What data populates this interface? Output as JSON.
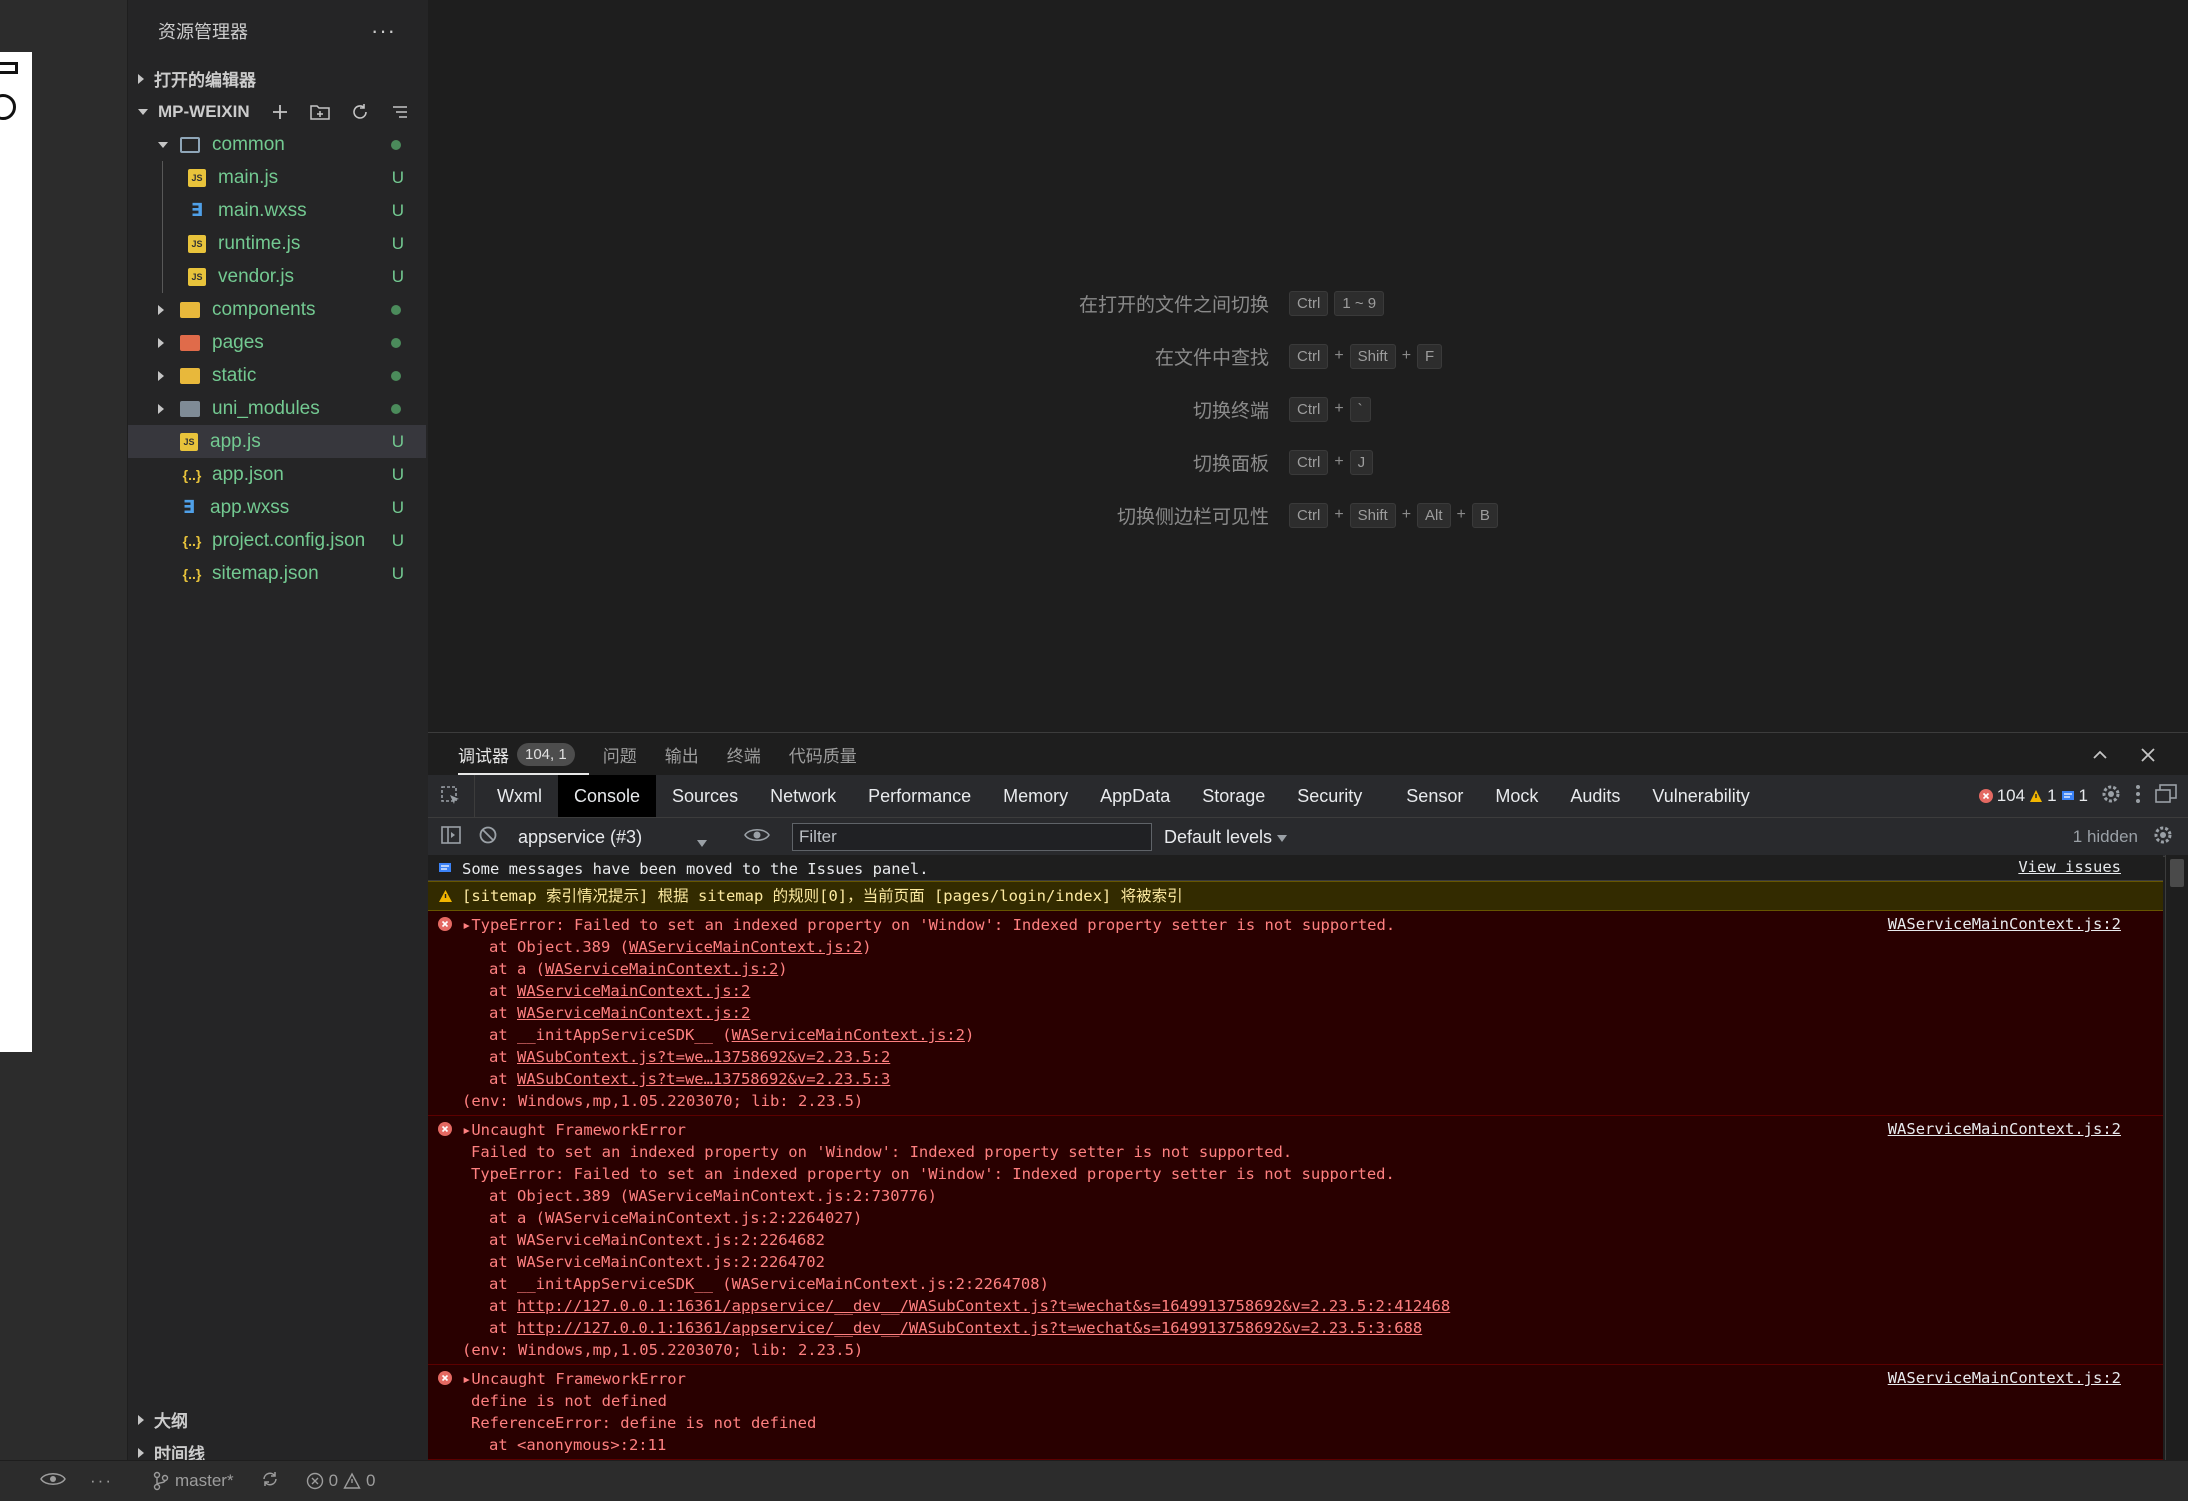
{
  "sidebar": {
    "title": "资源管理器",
    "more": "···",
    "open_editors_label": "打开的编辑器",
    "project_label": "MP-WEIXIN",
    "outline_label": "大纲",
    "timeline_label": "时间线",
    "tree": [
      {
        "name": "common",
        "type": "folder-open",
        "depth": 0,
        "status": "dot"
      },
      {
        "name": "main.js",
        "type": "js",
        "depth": 1,
        "status": "U"
      },
      {
        "name": "main.wxss",
        "type": "wxss",
        "depth": 1,
        "status": "U"
      },
      {
        "name": "runtime.js",
        "type": "js",
        "depth": 1,
        "status": "U"
      },
      {
        "name": "vendor.js",
        "type": "js",
        "depth": 1,
        "status": "U"
      },
      {
        "name": "components",
        "type": "folder",
        "depth": 0,
        "status": "dot"
      },
      {
        "name": "pages",
        "type": "folder-pages",
        "depth": 0,
        "status": "dot"
      },
      {
        "name": "static",
        "type": "folder",
        "depth": 0,
        "status": "dot"
      },
      {
        "name": "uni_modules",
        "type": "folder-gray",
        "depth": 0,
        "status": "dot"
      },
      {
        "name": "app.js",
        "type": "js",
        "depth": 0,
        "status": "U",
        "selected": true
      },
      {
        "name": "app.json",
        "type": "json",
        "depth": 0,
        "status": "U"
      },
      {
        "name": "app.wxss",
        "type": "wxss",
        "depth": 0,
        "status": "U"
      },
      {
        "name": "project.config.json",
        "type": "json",
        "depth": 0,
        "status": "U"
      },
      {
        "name": "sitemap.json",
        "type": "json",
        "depth": 0,
        "status": "U"
      }
    ]
  },
  "welcome": {
    "shortcuts": [
      {
        "label": "在打开的文件之间切换",
        "keys": [
          "Ctrl",
          "1 ~ 9"
        ],
        "joiner": false
      },
      {
        "label": "在文件中查找",
        "keys": [
          "Ctrl",
          "Shift",
          "F"
        ],
        "joiner": true
      },
      {
        "label": "切换终端",
        "keys": [
          "Ctrl",
          "`"
        ],
        "joiner": true
      },
      {
        "label": "切换面板",
        "keys": [
          "Ctrl",
          "J"
        ],
        "joiner": true
      },
      {
        "label": "切换侧边栏可见性",
        "keys": [
          "Ctrl",
          "Shift",
          "Alt",
          "B"
        ],
        "joiner": true
      }
    ],
    "plus": "+"
  },
  "panel": {
    "tabs": [
      {
        "label": "调试器",
        "badge": "104, 1",
        "active": true
      },
      {
        "label": "问题"
      },
      {
        "label": "输出"
      },
      {
        "label": "终端"
      },
      {
        "label": "代码质量"
      }
    ]
  },
  "devtools": {
    "tabs": [
      "Wxml",
      "Console",
      "Sources",
      "Network",
      "Performance",
      "Memory",
      "AppData",
      "Storage",
      "Security",
      "Sensor",
      "Mock",
      "Audits",
      "Vulnerability"
    ],
    "active_tab": "Console",
    "error_count": "104",
    "warning_count": "1",
    "info_count": "1",
    "context": "appservice (#3)",
    "filter_placeholder": "Filter",
    "levels": "Default levels",
    "hidden": "1 hidden"
  },
  "console": {
    "info_message": "Some messages have been moved to the Issues panel.",
    "view_issues": "View issues",
    "warning_message": "[sitemap 索引情况提示] 根据 sitemap 的规则[0]，当前页面 [pages/login/index] 将被索引",
    "errors": [
      {
        "source": "WAServiceMainContext.js:2",
        "lines": [
          {
            "t": "▸TypeError: Failed to set an indexed property on 'Window': Indexed property setter is not supported.",
            "i": 0
          },
          {
            "t": "at Object.389 (",
            "u": "WAServiceMainContext.js:2",
            "after": ")",
            "i": 3
          },
          {
            "t": "at a (",
            "u": "WAServiceMainContext.js:2",
            "after": ")",
            "i": 3
          },
          {
            "t": "at ",
            "u": "WAServiceMainContext.js:2",
            "after": "",
            "i": 3
          },
          {
            "t": "at ",
            "u": "WAServiceMainContext.js:2",
            "after": "",
            "i": 3
          },
          {
            "t": "at __initAppServiceSDK__ (",
            "u": "WAServiceMainContext.js:2",
            "after": ")",
            "i": 3
          },
          {
            "t": "at ",
            "u": "WASubContext.js?t=we…13758692&v=2.23.5:2",
            "after": "",
            "i": 3
          },
          {
            "t": "at ",
            "u": "WASubContext.js?t=we…13758692&v=2.23.5:3",
            "after": "",
            "i": 3
          },
          {
            "t": "(env: Windows,mp,1.05.2203070; lib: 2.23.5)",
            "i": 0
          }
        ]
      },
      {
        "source": "WAServiceMainContext.js:2",
        "lines": [
          {
            "t": "▸Uncaught FrameworkError",
            "i": 0
          },
          {
            "t": "Failed to set an indexed property on 'Window': Indexed property setter is not supported.",
            "i": 1
          },
          {
            "t": "TypeError: Failed to set an indexed property on 'Window': Indexed property setter is not supported.",
            "i": 1
          },
          {
            "t": "at Object.389 (WAServiceMainContext.js:2:730776)",
            "i": 3
          },
          {
            "t": "at a (WAServiceMainContext.js:2:2264027)",
            "i": 3
          },
          {
            "t": "at WAServiceMainContext.js:2:2264682",
            "i": 3
          },
          {
            "t": "at WAServiceMainContext.js:2:2264702",
            "i": 3
          },
          {
            "t": "at __initAppServiceSDK__ (WAServiceMainContext.js:2:2264708)",
            "i": 3
          },
          {
            "t": "at ",
            "u": "http://127.0.0.1:16361/appservice/__dev__/WASubContext.js?t=wechat&s=1649913758692&v=2.23.5:2:412468",
            "after": "",
            "i": 3
          },
          {
            "t": "at ",
            "u": "http://127.0.0.1:16361/appservice/__dev__/WASubContext.js?t=wechat&s=1649913758692&v=2.23.5:3:688",
            "after": "",
            "i": 3
          },
          {
            "t": "(env: Windows,mp,1.05.2203070; lib: 2.23.5)",
            "i": 0
          }
        ]
      },
      {
        "source": "WAServiceMainContext.js:2",
        "lines": [
          {
            "t": "▸Uncaught FrameworkError",
            "i": 0
          },
          {
            "t": "define is not defined",
            "i": 1
          },
          {
            "t": "ReferenceError: define is not defined",
            "i": 1
          },
          {
            "t": "at <anonymous>:2:11",
            "i": 3
          }
        ]
      }
    ]
  },
  "statusbar": {
    "branch": "master*",
    "errors": "0",
    "warnings": "0"
  },
  "colors": {
    "accent_green": "#73c991",
    "error_red": "#ff8080",
    "warning_yellow": "#fce9a0"
  }
}
